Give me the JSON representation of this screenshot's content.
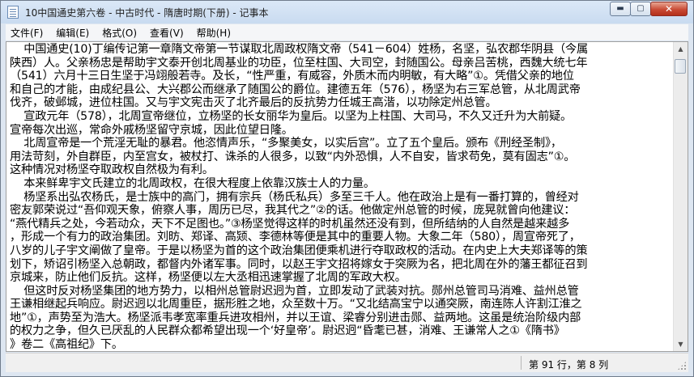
{
  "window": {
    "title": "10中国通史第六卷 - 中古时代 - 隋唐时期(下册) - 记事本",
    "minimize_glyph": "▬",
    "maximize_glyph": "▢",
    "close_glyph": "✕"
  },
  "menu": {
    "items": [
      {
        "id": "file",
        "label": "文件(F)"
      },
      {
        "id": "edit",
        "label": "编辑(E)"
      },
      {
        "id": "format",
        "label": "格式(O)"
      },
      {
        "id": "view",
        "label": "查看(V)"
      },
      {
        "id": "help",
        "label": "帮助(H)"
      }
    ]
  },
  "editor": {
    "lines": [
      "    中国通史(10)丁编传记第一章隋文帝第一节谋取北周政权隋文帝（541－604）姓杨，名坚，弘农郡华阴县（今属",
      "陕西）人。父亲杨忠是帮助宇文泰开创北周基业的功臣，位至柱国、大司空，封随国公。母亲吕苦桃，西魏大统七年",
      "（541）六月十三日生坚于冯翊般若寺。及长，“性严重，有威容，外质木而内明敏，有大略”①。凭借父亲的地位",
      "和自己的才能，由成纪县公、大兴郡公而继承了随国公的爵位。建德五年（576），杨坚为右三军总管，从北周武帝",
      "伐齐，破邺城，进位柱国。又与宇文宪击灭了北齐最后的反抗势力任城王高湝，以功除定州总管。",
      "    宣政元年（578），北周宣帝继位，立杨坚的长女丽华为皇后。以坚为上柱国、大司马，不久又迁升为大前疑。",
      "宣帝每次出巡，常命外戚杨坚留守京城，因此位望日隆。",
      "    北周宣帝是一个荒淫无耻的暴君。他恣情声乐，“多聚美女，以实后宫”。立了五个皇后。颁布《刑经圣制》，",
      "用法苛刻，外自群臣，内至宫女，被杖打、诛杀的人很多，以致“内外恐惧，人不自安，皆求苟免，莫有固志”①。",
      "这种情况对杨坚夺取政权自然极为有利。",
      "    本来鲜卑宇文氏建立的北周政权，在很大程度上依靠汉族士人的力量。",
      "    杨坚系出弘农杨氏，是士族中的高门，拥有宗兵（杨氏私兵）多至三千人。他在政治上是有一番打算的，曾经对",
      "密友郭荣说过“吾仰观天象，俯察人事，周历已尽，我其代之”②的话。他做定州总管的时候，庞晃就曾向他建议：",
      "“燕代精兵之处，今若动众，天下不足图也。”③杨坚觉得这样的时机虽然还没有到，但所结纳的人自然是越来越多",
      "，形成一个有力的政治集团。刘昉、郑译、高颎、李德林等便是其中的重要人物。大象二年（580），周宣帝死了，",
      "八岁的儿子宇文阐做了皇帝。于是以杨坚为首的这个政治集团便乘机进行夺取政权的活动。在内史上大夫郑译等的策",
      "划下，矫诏引杨坚入总朝政，都督内外诸军事。同时，以赵王宇文招将嫁女于突厥为名，把北周在外的藩王都征召到",
      "京城来，防止他们反抗。这样，杨坚便以左大丞相迅速掌握了北周的军政大权。",
      "    但这时反对杨坚集团的地方势力，以相州总管尉迟迥为首，立即发动了武装对抗。郧州总管司马消难、益州总管",
      "王谦相继起兵响应。尉迟迥以北周重臣，据形胜之地，众至数十万。“又北结高宝宁以通突厥，南连陈人许割江淮之",
      "地”①，声势至为浩大。杨坚派韦孝宽率重兵进攻相州，并以王谊、梁睿分别进击郧、益两地。这虽是统治阶级内部",
      "的权力之争，但久已厌乱的人民群众都希望出现一个‘好皇帝’。尉迟迥“昏耄已甚，消难、王谦常人之①《隋书》",
      "》卷二《高祖纪》下。"
    ]
  },
  "status": {
    "position": "第 91 行，第 8 列"
  }
}
